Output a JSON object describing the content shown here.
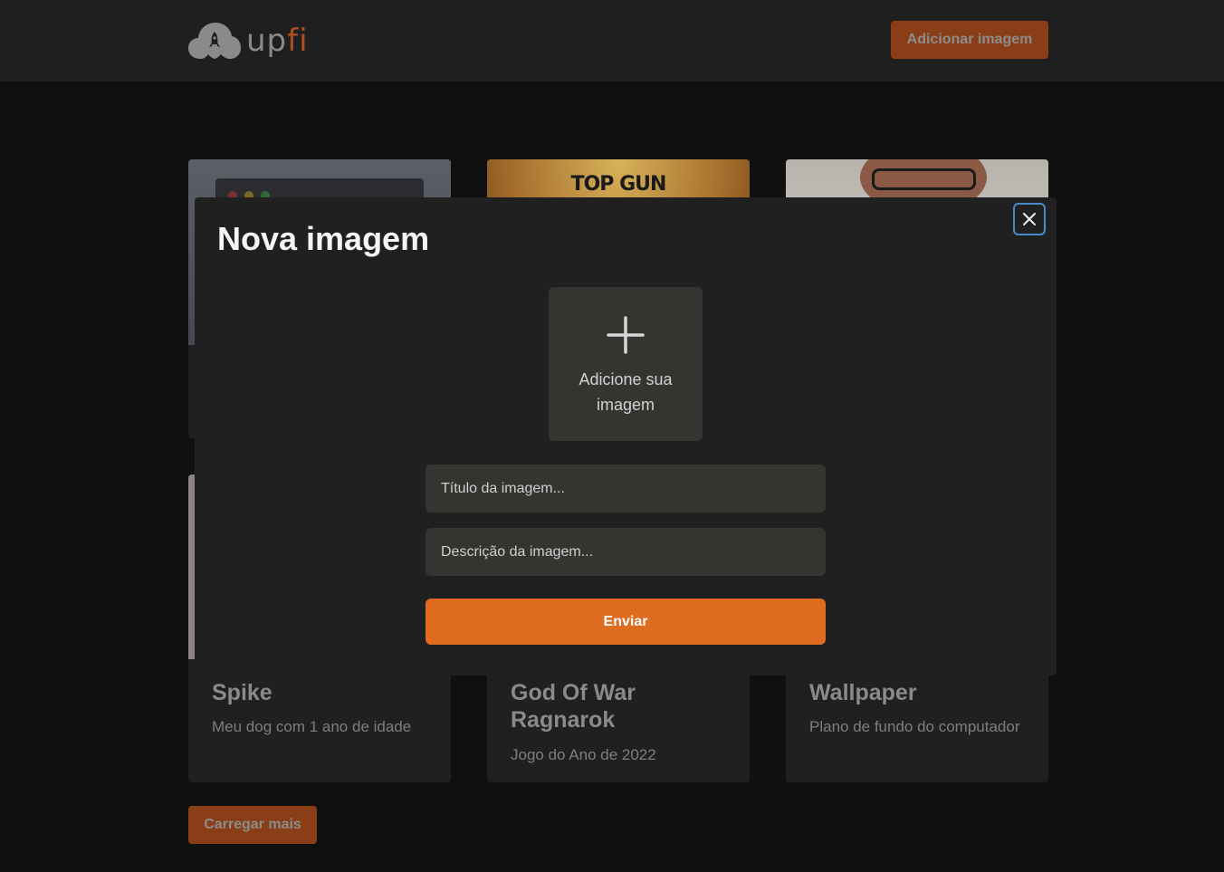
{
  "header": {
    "logo_up": "up",
    "logo_fi": "fi",
    "add_button": "Adicionar imagem"
  },
  "cards": [
    {
      "title": "Spike",
      "description": "Meu dog com 1 ano de idade"
    },
    {
      "title": "God Of War Ragnarok",
      "description": "Jogo do Ano de 2022"
    },
    {
      "title": "Wallpaper",
      "description": "Plano de fundo do computador"
    }
  ],
  "top_cards": [
    {
      "image_text": ""
    },
    {
      "image_text": "TOP GUN"
    },
    {
      "image_text": ""
    }
  ],
  "load_more": "Carregar mais",
  "modal": {
    "title": "Nova imagem",
    "upload_label": "Adicione sua imagem",
    "title_placeholder": "Título da imagem...",
    "description_placeholder": "Descrição da imagem...",
    "submit": "Enviar"
  },
  "colors": {
    "accent": "#dd6b20",
    "accent_dim": "#8a3e17",
    "background": "#101010",
    "surface": "#202020",
    "input": "#353431",
    "focus_ring": "#4a8ac9"
  }
}
